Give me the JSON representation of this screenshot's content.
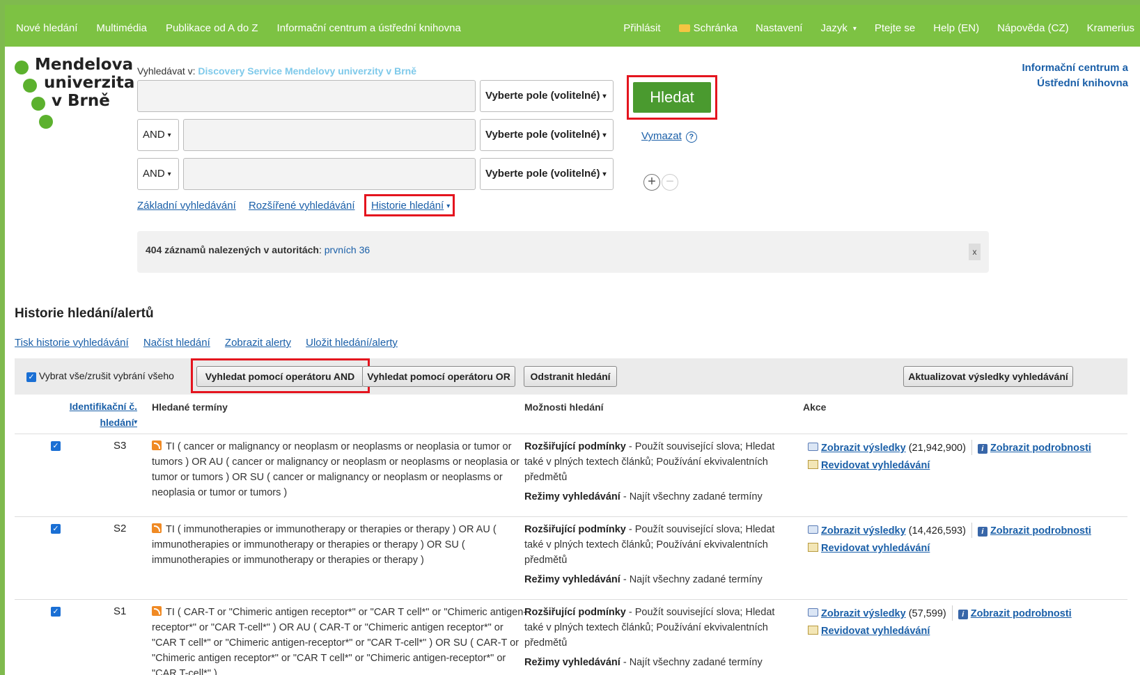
{
  "topnav": {
    "left": [
      "Nové hledání",
      "Multimédia",
      "Publikace od A do Z",
      "Informační centrum a ústřední knihovna"
    ],
    "right": [
      "Přihlásit",
      "Schránka",
      "Nastavení",
      "Jazyk",
      "Ptejte se",
      "Help (EN)",
      "Nápověda (CZ)",
      "Kramerius"
    ]
  },
  "logo": {
    "line1": "Mendelova",
    "line2": "univerzita",
    "line3": "v Brně"
  },
  "ic_link": {
    "line1": "Informační centrum a",
    "line2": "Ústřední knihovna"
  },
  "search": {
    "label": "Vyhledávat v:",
    "database": "Discovery Service Mendelovy univerzity v Brně",
    "field_select": "Vyberte pole (volitelné)",
    "bool": "AND",
    "submit": "Hledat",
    "clear": "Vymazat",
    "help": "?"
  },
  "tabs": {
    "basic": "Základní vyhledávání",
    "advanced": "Rozšířené vyhledávání",
    "history": "Historie hledání"
  },
  "notice": {
    "bold": "404 záznamů nalezených v autoritách",
    "sep": ":",
    "link": "prvních 36",
    "close": "x"
  },
  "history": {
    "title": "Historie hledání/alertů",
    "links": [
      "Tisk historie vyhledávání",
      "Načíst hledání",
      "Zobrazit alerty",
      "Uložit hledání/alerty"
    ],
    "select_all": "Vybrat vše/zrušit vybrání všeho",
    "btn_and": "Vyhledat pomocí operátoru AND",
    "btn_or": "Vyhledat pomocí operátoru OR",
    "btn_remove": "Odstranit hledání",
    "btn_refresh": "Aktualizovat výsledky vyhledávání",
    "col_id_1": "Identifikační č.",
    "col_id_2": "hledání",
    "col_terms": "Hledané termíny",
    "col_opts": "Možnosti hledání",
    "col_actions": "Akce",
    "rows": [
      {
        "id": "S3",
        "terms": "TI ( cancer or malignancy or neoplasm or neoplasms or neoplasia or tumor or tumors ) OR AU ( cancer or malignancy or neoplasm or neoplasms or neoplasia or tumor or tumors ) OR SU ( cancer or malignancy or neoplasm or neoplasms or neoplasia or tumor or tumors )",
        "opt1_b": "Rozšiřující podmínky",
        "opt1": " - Použít související slova; Hledat také v plných textech článků; Používání ekvivalentních předmětů",
        "opt2_b": "Režimy vyhledávání",
        "opt2": " - Najít všechny zadané termíny",
        "show": "Zobrazit výsledky",
        "count": "(21,942,900)",
        "details": "Zobrazit podrobnosti",
        "revise": "Revidovat vyhledávání"
      },
      {
        "id": "S2",
        "terms": "TI ( immunotherapies or immunotherapy or therapies or therapy ) OR AU ( immunotherapies or immunotherapy or therapies or therapy ) OR SU ( immunotherapies or immunotherapy or therapies or therapy )",
        "opt1_b": "Rozšiřující podmínky",
        "opt1": " - Použít související slova; Hledat také v plných textech článků; Používání ekvivalentních předmětů",
        "opt2_b": "Režimy vyhledávání",
        "opt2": " - Najít všechny zadané termíny",
        "show": "Zobrazit výsledky",
        "count": "(14,426,593)",
        "details": "Zobrazit podrobnosti",
        "revise": "Revidovat vyhledávání"
      },
      {
        "id": "S1",
        "terms": "TI ( CAR-T or \"Chimeric antigen receptor*\" or \"CAR T cell*\" or \"Chimeric antigen-receptor*\" or \"CAR T-cell*\" ) OR AU ( CAR-T or \"Chimeric antigen receptor*\" or \"CAR T cell*\" or \"Chimeric antigen-receptor*\" or \"CAR T-cell*\" ) OR SU ( CAR-T or \"Chimeric antigen receptor*\" or \"CAR T cell*\" or \"Chimeric antigen-receptor*\" or \"CAR T-cell*\" )",
        "opt1_b": "Rozšiřující podmínky",
        "opt1": " - Použít související slova; Hledat také v plných textech článků; Používání ekvivalentních předmětů",
        "opt2_b": "Režimy vyhledávání",
        "opt2": " - Najít všechny zadané termíny",
        "show": "Zobrazit výsledky",
        "count": "(57,599)",
        "details": "Zobrazit podrobnosti",
        "revise": "Revidovat vyhledávání"
      }
    ]
  },
  "colors": {
    "topbar": "#7dc243",
    "highlight": "#e4141e",
    "submit": "#4a9a2f",
    "link": "#1a5fa8"
  },
  "icons": [
    "folder-icon",
    "caret-down-icon",
    "help-icon",
    "plus-icon",
    "minus-icon",
    "close-icon",
    "checkbox-icon",
    "sort-icon",
    "rss-icon",
    "magnifier-icon",
    "pencil-icon",
    "info-icon"
  ]
}
